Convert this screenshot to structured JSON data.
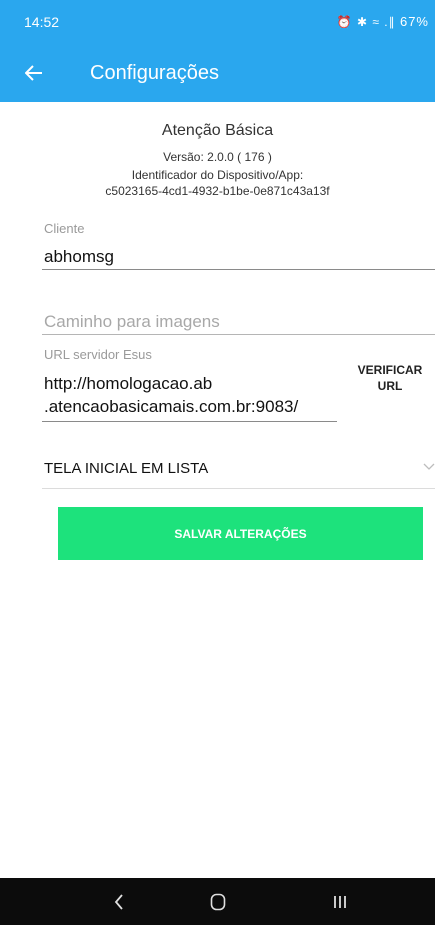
{
  "status_bar": {
    "time": "14:52",
    "indicators": "⏰ ✱ ≈ .∥",
    "battery": "67%"
  },
  "app_bar": {
    "title": "Configurações"
  },
  "info": {
    "app_name": "Atenção Básica",
    "version": "Versão: 2.0.0 ( 176 )",
    "device_label": "Identificador do Dispositivo/App:",
    "device_id": "c5023165-4cd1-4932-b1be-0e871c43a13f"
  },
  "form": {
    "client_label": "Cliente",
    "client_value": "abhomsg",
    "images_path_placeholder": "Caminho para imagens",
    "url_label": "URL servidor Esus",
    "url_value_line1": "http://homologacao.ab",
    "url_value_line2": ".atencaobasicamais.com.br:9083/",
    "verify_line1": "VERIFICAR",
    "verify_line2": "URL",
    "home_screen_option": "TELA INICIAL EM LISTA",
    "save_label": "SALVAR ALTERAÇÕES"
  },
  "colors": {
    "app_bar": "#2aa7ee",
    "save_button": "#1de27c",
    "nav_bar": "#0c0c0c"
  },
  "icons": {
    "back": "arrow-left-icon",
    "dropdown": "chevron-down-icon",
    "nav_back": "chevron-left-icon",
    "nav_home": "home-icon",
    "nav_recents": "recents-icon"
  }
}
